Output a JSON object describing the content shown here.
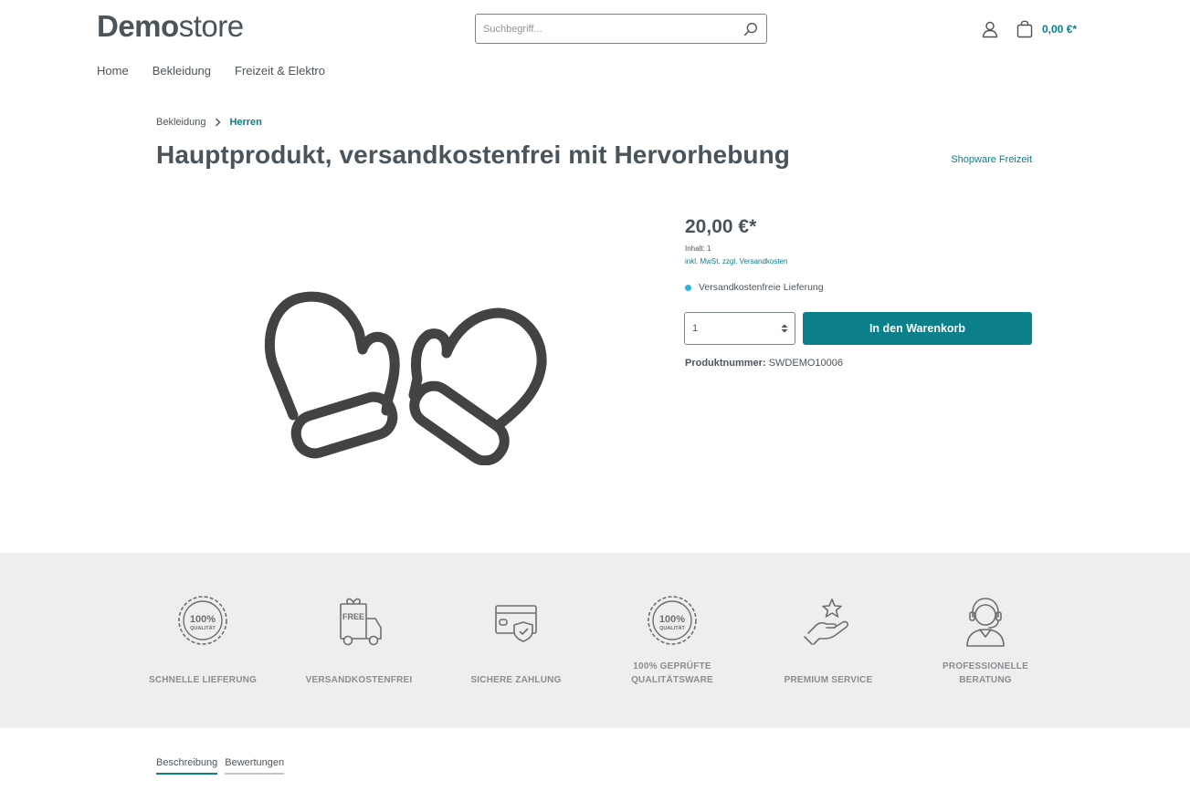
{
  "header": {
    "logo_bold": "Demo",
    "logo_light": "store",
    "search_placeholder": "Suchbegriff...",
    "cart_total": "0,00 €*",
    "icons": {
      "search": "search-icon",
      "account": "user-icon",
      "cart": "shopping-bag-icon"
    }
  },
  "nav": {
    "items": [
      "Home",
      "Bekleidung",
      "Freizeit & Elektro"
    ]
  },
  "breadcrumb": {
    "items": [
      "Bekleidung",
      "Herren"
    ]
  },
  "product": {
    "title": "Hauptprodukt, versandkostenfrei mit Hervorhebung",
    "manufacturer": "Shopware Freizeit",
    "image_icon": "mittens-icon",
    "price": "20,00 €*",
    "content": "Inhalt: 1",
    "tax_info": "inkl. MwSt. zzgl. Versandkosten",
    "delivery": "Versandkostenfreie Lieferung",
    "quantity": "1",
    "buy_label": "In den Warenkorb",
    "number_label": "Produktnummer:",
    "number_value": "SWDEMO10006"
  },
  "benefits": [
    {
      "label": "SCHNELLE LIEFERUNG",
      "icon": "quality-seal-icon"
    },
    {
      "label": "VERSANDKOSTENFREI",
      "icon": "free-delivery-truck-icon"
    },
    {
      "label": "SICHERE ZAHLUNG",
      "icon": "secure-payment-card-icon"
    },
    {
      "label_line1": "100% GEPRÜFTE",
      "label_line2": "QUALITÄTSWARE",
      "icon": "quality-seal-icon"
    },
    {
      "label": "PREMIUM SERVICE",
      "icon": "star-hand-icon"
    },
    {
      "label_line1": "PROFESSIONELLE",
      "label_line2": "BERATUNG",
      "icon": "headset-agent-icon"
    }
  ],
  "seal_text_top": "100%",
  "seal_text_bottom": "QUALITÄT",
  "truck_text": "FREE",
  "tabs": [
    "Beschreibung",
    "Bewertungen"
  ],
  "colors": {
    "accent": "#0b7f8a",
    "text": "#4a545b",
    "delivery_dot": "#2eb3d9",
    "benefits_bg": "#eeeeee"
  }
}
